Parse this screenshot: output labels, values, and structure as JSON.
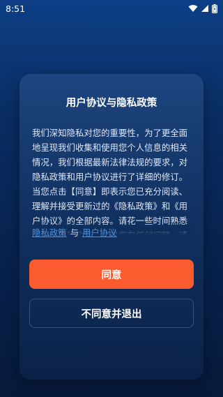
{
  "status_bar": {
    "time": "8:51",
    "icons": [
      "wifi-icon",
      "signal-icon",
      "battery-icon"
    ]
  },
  "dialog": {
    "title": "用户协议与隐私政策",
    "body": "我们深知隐私对您的重要性，为了更全面地呈现我们收集和使用您个人信息的相关情况，我们根据最新法律法规的要求，对隐私政策和用户协议进行了详细的修订。当您点击【同意】即表示您已充分阅读、理解并接受更新过的《隐私政策》和《用户协议》的全部内容。请花一些时间熟悉我们的隐私政策，如果您有任何问题，请联系我们。",
    "privacy_link": "隐私政策",
    "link_separator": "与",
    "agreement_link": "用户协议",
    "agree_button": "同意",
    "decline_button": "不同意并退出"
  },
  "colors": {
    "background_top": "#0d3f86",
    "background_bottom": "#071a3b",
    "accent": "#fb5b2f",
    "link": "#4a8fd8"
  }
}
